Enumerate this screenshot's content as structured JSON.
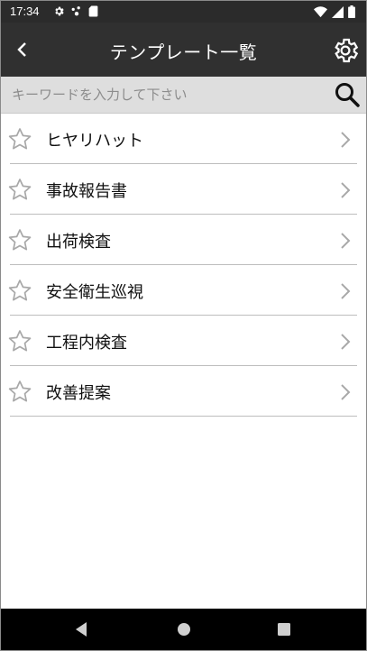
{
  "status_bar": {
    "time": "17:34",
    "icons_left": [
      "gear-icon",
      "network-icon",
      "sd-card-icon"
    ],
    "icons_right": [
      "wifi-icon",
      "signal-icon",
      "battery-icon"
    ]
  },
  "app_bar": {
    "title": "テンプレート一覧",
    "back_icon": "chevron-left-icon",
    "settings_icon": "gear-icon"
  },
  "search": {
    "placeholder": "キーワードを入力して下さい",
    "value": "",
    "icon": "search-icon"
  },
  "templates": [
    {
      "label": "ヒヤリハット",
      "favorite": false
    },
    {
      "label": "事故報告書",
      "favorite": false
    },
    {
      "label": "出荷検査",
      "favorite": false
    },
    {
      "label": "安全衛生巡視",
      "favorite": false
    },
    {
      "label": "工程内検査",
      "favorite": false
    },
    {
      "label": "改善提案",
      "favorite": false
    }
  ],
  "navigation": {
    "buttons": [
      "back-icon",
      "home-icon",
      "recents-icon"
    ]
  },
  "colors": {
    "status_bar": "#2b2b2b",
    "app_bar": "#303030",
    "search_bar": "#dedede",
    "divider": "#bdbdbd",
    "nav_bar": "#000000"
  }
}
